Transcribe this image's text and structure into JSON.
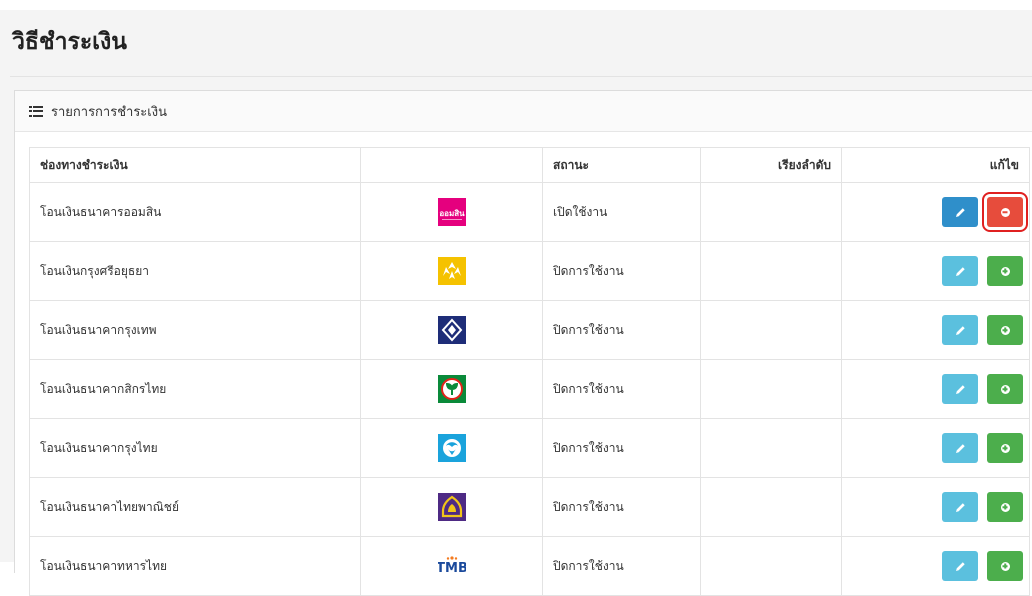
{
  "page": {
    "title": "วิธีชำระเงิน"
  },
  "panel": {
    "heading": "รายการการชำระเงิน",
    "icon": "list-icon"
  },
  "table": {
    "headers": {
      "channel": "ช่องทางชำระเงิน",
      "logo": "",
      "status": "สถานะ",
      "order": "เรียงลำดับ",
      "edit": "แก้ไข"
    },
    "rows": [
      {
        "channel": "โอนเงินธนาคารออมสิน",
        "status": "เปิดใช้งาน",
        "order": "",
        "logo": "gsb-logo",
        "logo_color": "#e5007e",
        "action": "remove"
      },
      {
        "channel": "โอนเงินกรุงศรีอยุธยา",
        "status": "ปิดการใช้งาน",
        "order": "",
        "logo": "krungsri-logo",
        "logo_color": "#f5c200",
        "action": "add"
      },
      {
        "channel": "โอนเงินธนาคากรุงเทพ",
        "status": "ปิดการใช้งาน",
        "order": "",
        "logo": "bangkok-bank-logo",
        "logo_color": "#1e2d78",
        "action": "add"
      },
      {
        "channel": "โอนเงินธนาคากสิกรไทย",
        "status": "ปิดการใช้งาน",
        "order": "",
        "logo": "kasikorn-logo",
        "logo_color": "#0a8a3a",
        "action": "add"
      },
      {
        "channel": "โอนเงินธนาคากรุงไทย",
        "status": "ปิดการใช้งาน",
        "order": "",
        "logo": "krungthai-logo",
        "logo_color": "#1aa3dc",
        "action": "add"
      },
      {
        "channel": "โอนเงินธนาคาไทยพาณิชย์",
        "status": "ปิดการใช้งาน",
        "order": "",
        "logo": "scb-logo",
        "logo_color": "#4e2a84",
        "action": "add"
      },
      {
        "channel": "โอนเงินธนาคาทหารไทย",
        "status": "ปิดการใช้งาน",
        "order": "",
        "logo": "tmb-logo",
        "logo_color": "#1b4a9c",
        "action": "add"
      }
    ]
  },
  "logo_text": {
    "gsb": "ออมสิน",
    "tmb": "TMB"
  },
  "colors": {
    "edit": "#5bc0de",
    "edit_active": "#2f8fca",
    "add": "#4cae4c",
    "remove": "#e74c3c",
    "highlight": "#e02020"
  }
}
